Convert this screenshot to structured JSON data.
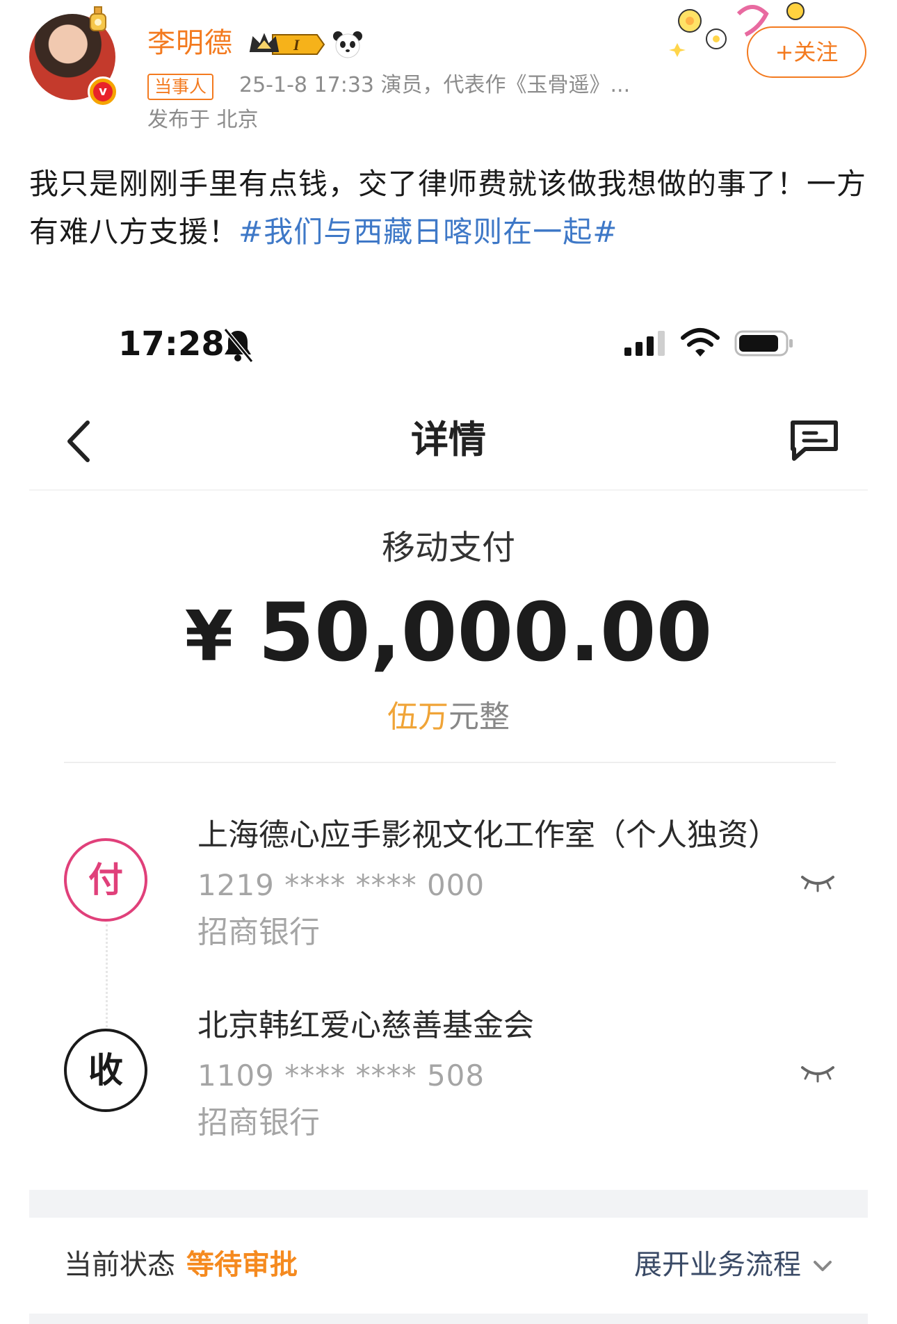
{
  "post": {
    "username": "李明德",
    "role_tag": "当事人",
    "meta": "25-1-8 17:33  演员，代表作《玉骨遥》...",
    "location": "发布于 北京",
    "follow_label": "+关注",
    "text_main": "我只是刚刚手里有点钱，交了律师费就该做我想做的事了！一方有难八方支援！",
    "hashtag": "#我们与西藏日喀则在一起#",
    "vip_badge_text": "I",
    "verified_badge_text": "v",
    "accent_color": "#f37a1f",
    "hashtag_color": "#3e78c7"
  },
  "phone": {
    "status_time": "17:28",
    "nav_title": "详情",
    "pay_type": "移动支付",
    "currency_symbol": "¥",
    "amount": "50,000.00",
    "amount_words_highlight": "伍万",
    "amount_words_rest": "元整",
    "payer": {
      "badge": "付",
      "name": "上海德心应手影视文化工作室（个人独资）",
      "account": "1219 **** **** 000",
      "bank": "招商银行",
      "color": "#e0407a"
    },
    "payee": {
      "badge": "收",
      "name": "北京韩红爱心慈善基金会",
      "account": "1109 **** **** 508",
      "bank": "招商银行"
    },
    "status_label": "当前状态",
    "status_value": "等待审批",
    "status_color": "#f58a1f",
    "expand_label": "展开业务流程"
  }
}
